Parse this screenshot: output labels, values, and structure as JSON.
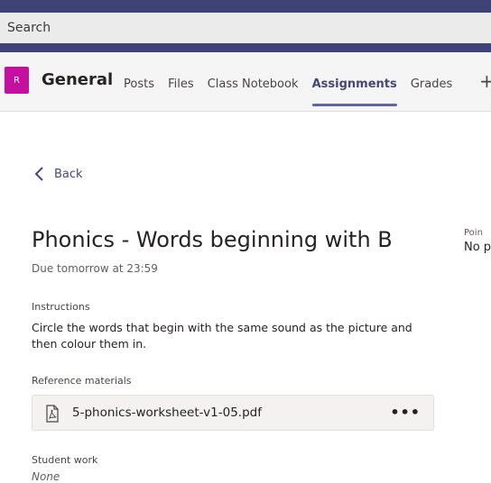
{
  "search": {
    "placeholder": "Search"
  },
  "channel": {
    "avatar_initial": "R",
    "name": "General",
    "tabs": [
      {
        "label": "Posts"
      },
      {
        "label": "Files"
      },
      {
        "label": "Class Notebook"
      },
      {
        "label": "Assignments",
        "active": true
      },
      {
        "label": "Grades"
      }
    ],
    "add_tab_symbol": "+"
  },
  "nav": {
    "back_label": "Back"
  },
  "assignment": {
    "title": "Phonics - Words beginning with B",
    "due": "Due tomorrow at 23:59",
    "points_label": "Poin",
    "points_value": "No p",
    "instructions_label": "Instructions",
    "instructions_text": "Circle the words that begin with the same sound as the picture and then colour them in.",
    "reference_label": "Reference materials",
    "reference_file": "5-phonics-worksheet-v1-05.pdf",
    "more_options": "•••",
    "student_work_label": "Student work",
    "student_work_value": "None"
  },
  "colors": {
    "accent": "#6264a7",
    "header_dark": "#3f4277",
    "avatar": "#c40fa0"
  },
  "icons": [
    "chevron-left-icon",
    "pdf-file-icon",
    "more-options-icon",
    "add-tab-icon"
  ]
}
